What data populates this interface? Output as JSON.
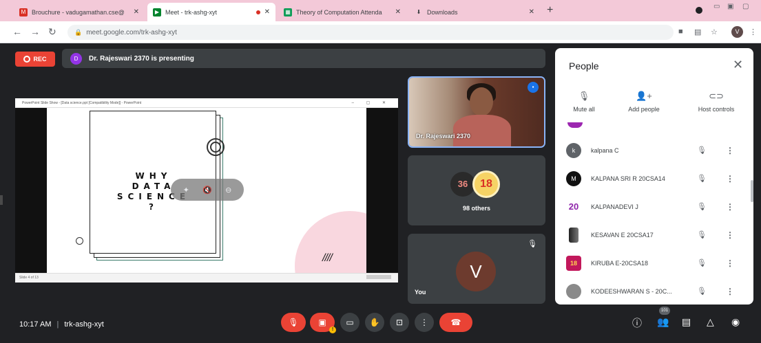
{
  "browser": {
    "tabs": [
      {
        "title": "Brouchure - vadugamathan.cse@",
        "icon": "gmail-icon",
        "active": false
      },
      {
        "title": "Meet - trk-ashg-xyt",
        "icon": "meet-icon",
        "active": true
      },
      {
        "title": "Theory of Computation Attenda",
        "icon": "sheets-icon",
        "active": false
      },
      {
        "title": "Downloads",
        "icon": "download-icon",
        "active": false
      }
    ],
    "new_tab": "+",
    "url": "meet.google.com/trk-ashg-xyt",
    "profile_initial": "V"
  },
  "meet": {
    "rec_label": "REC",
    "presenter_initial": "D",
    "presenting_text": "Dr. Rajeswari 2370 is presenting",
    "presentation": {
      "window_title": "PowerPoint Slide Show - [Data science.ppt [Compatibility Mode]] - PowerPoint",
      "slide_title_lines": [
        "WHY",
        "DATA",
        "SCIENCE",
        "?"
      ],
      "hatch_text": "////",
      "status_left": "Slide 4 of 13"
    },
    "tiles": {
      "presenter_name": "Dr. Rajeswari 2370",
      "others_count_a": "36",
      "others_count_b": "18",
      "others_label": "98 others",
      "you_initial": "V",
      "you_label": "You"
    }
  },
  "people_panel": {
    "title": "People",
    "controls": [
      {
        "label": "Mute all",
        "icon": "mic-off-icon"
      },
      {
        "label": "Add people",
        "icon": "add-person-icon"
      },
      {
        "label": "Host controls",
        "icon": "toggle-icon"
      }
    ],
    "participants": [
      {
        "name": "kalpana C",
        "avatar": "k",
        "color": "#5f6368"
      },
      {
        "name": "KALPANA SRI R 20CSA14",
        "avatar": "M",
        "color": "#111111"
      },
      {
        "name": "KALPANADEVI J",
        "avatar": "20",
        "color": "#ffffff"
      },
      {
        "name": "KESAVAN E 20CSA17",
        "avatar": "",
        "color": "#444444"
      },
      {
        "name": "KIRUBA E-20CSA18",
        "avatar": "18",
        "color": "#c2185b"
      },
      {
        "name": "KODEESHWARAN S - 20C...",
        "avatar": "",
        "color": "#8a8a8a"
      }
    ]
  },
  "bottom_bar": {
    "time": "10:17 AM",
    "meeting_code": "trk-ashg-xyt",
    "participant_count": "101",
    "alert": "!"
  },
  "colors": {
    "accent_red": "#ea4335",
    "tab_bar": "#f3c9d8",
    "meet_bg": "#202124",
    "tile_bg": "#3c4043",
    "speaking_blue": "#8ab4f8"
  }
}
